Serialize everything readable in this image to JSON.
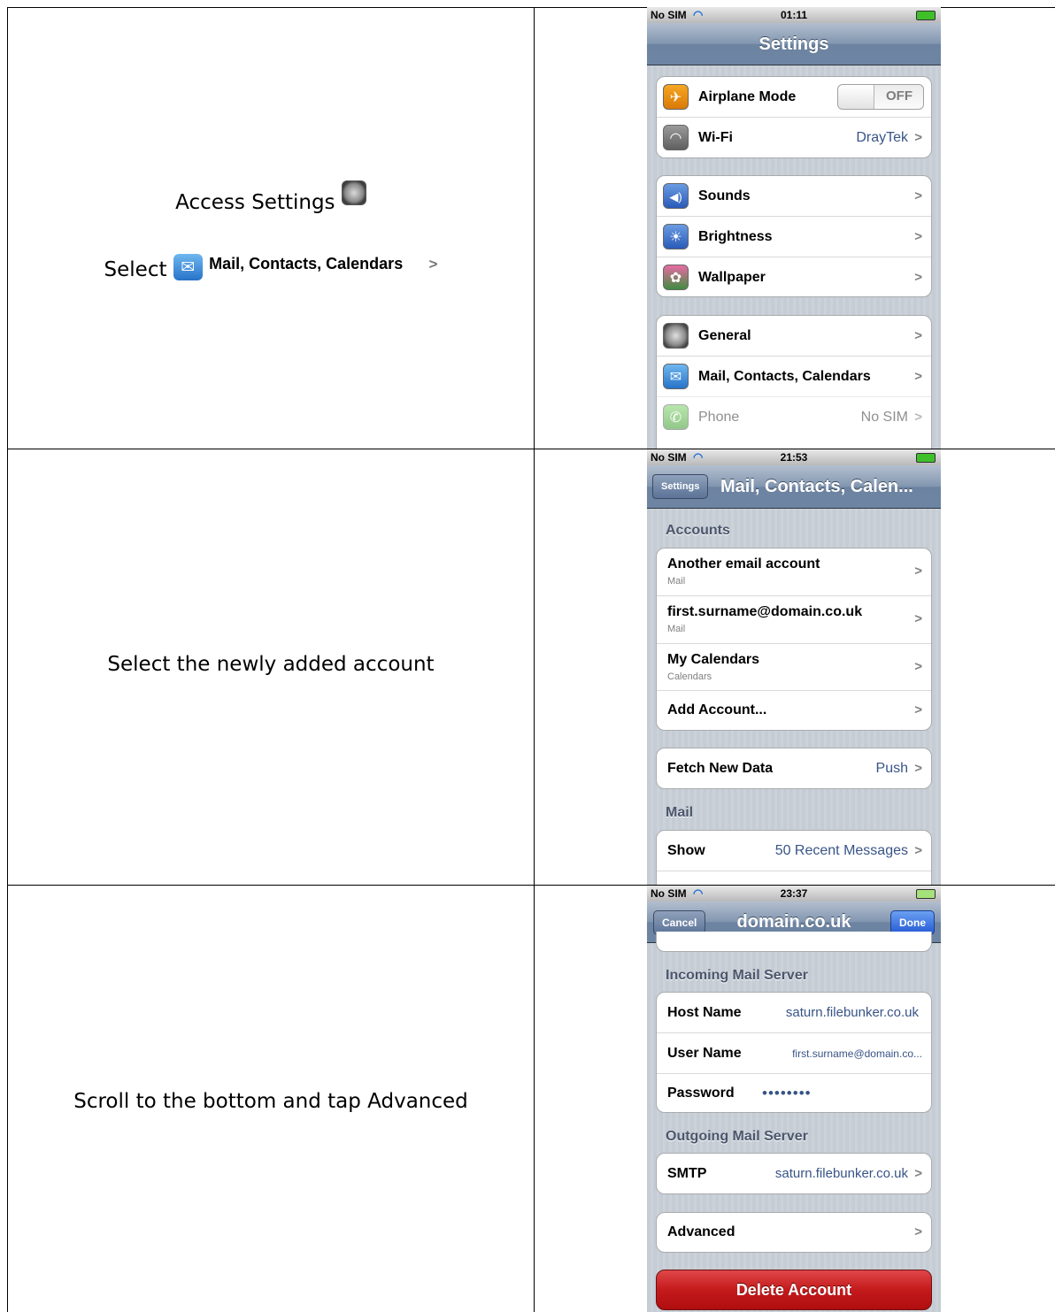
{
  "rows": [
    {
      "instructions": [
        {
          "text": "Access Settings",
          "icon": "settings-gear-icon"
        },
        {
          "prefix": "Select",
          "icon": "mail-icon",
          "label": "Mail, Contacts, Calendars",
          "chevron": ">"
        }
      ],
      "screen": {
        "status": {
          "carrier": "No SIM",
          "time": "01:11"
        },
        "title": "Settings",
        "groups": [
          [
            {
              "icon": "airplane-icon",
              "label": "Airplane Mode",
              "toggle": "OFF"
            },
            {
              "icon": "wifi-icon",
              "label": "Wi-Fi",
              "value": "DrayTek"
            }
          ],
          [
            {
              "icon": "sounds-icon",
              "label": "Sounds"
            },
            {
              "icon": "brightness-icon",
              "label": "Brightness"
            },
            {
              "icon": "wallpaper-icon",
              "label": "Wallpaper"
            }
          ],
          [
            {
              "icon": "general-gear-icon",
              "label": "General"
            },
            {
              "icon": "mail-icon",
              "label": "Mail, Contacts, Calendars"
            },
            {
              "icon": "phone-icon",
              "label": "Phone",
              "value": "No SIM"
            }
          ]
        ]
      }
    },
    {
      "instructions": [
        {
          "text": "Select the newly added account"
        }
      ],
      "screen": {
        "status": {
          "carrier": "No SIM",
          "time": "21:53"
        },
        "back": "Settings",
        "title": "Mail, Contacts, Calen...",
        "section_accounts": "Accounts",
        "accounts": [
          {
            "label": "Another email account",
            "sub": "Mail"
          },
          {
            "label": "first.surname@domain.co.uk",
            "sub": "Mail"
          },
          {
            "label": "My Calendars",
            "sub": "Calendars"
          },
          {
            "label": "Add Account..."
          }
        ],
        "fetch": {
          "label": "Fetch New Data",
          "value": "Push"
        },
        "section_mail": "Mail",
        "show": {
          "label": "Show",
          "value": "50 Recent Messages"
        }
      }
    },
    {
      "instructions": [
        {
          "text": "Scroll to the bottom and tap Advanced"
        }
      ],
      "screen": {
        "status": {
          "carrier": "No SIM",
          "time": "23:37"
        },
        "cancel": "Cancel",
        "title": "domain.co.uk",
        "done": "Done",
        "section_incoming": "Incoming Mail Server",
        "incoming": [
          {
            "label": "Host Name",
            "value": "saturn.filebunker.co.uk"
          },
          {
            "label": "User Name",
            "value": "first.surname@domain.co..."
          },
          {
            "label": "Password",
            "value": "••••••••"
          }
        ],
        "section_outgoing": "Outgoing Mail Server",
        "smtp": {
          "label": "SMTP",
          "value": "saturn.filebunker.co.uk"
        },
        "advanced": "Advanced",
        "delete": "Delete Account"
      }
    }
  ],
  "colors": {
    "ios_blue": "#385487",
    "nav_bar": "#6d84a2",
    "delete_red": "#c41a1c"
  }
}
